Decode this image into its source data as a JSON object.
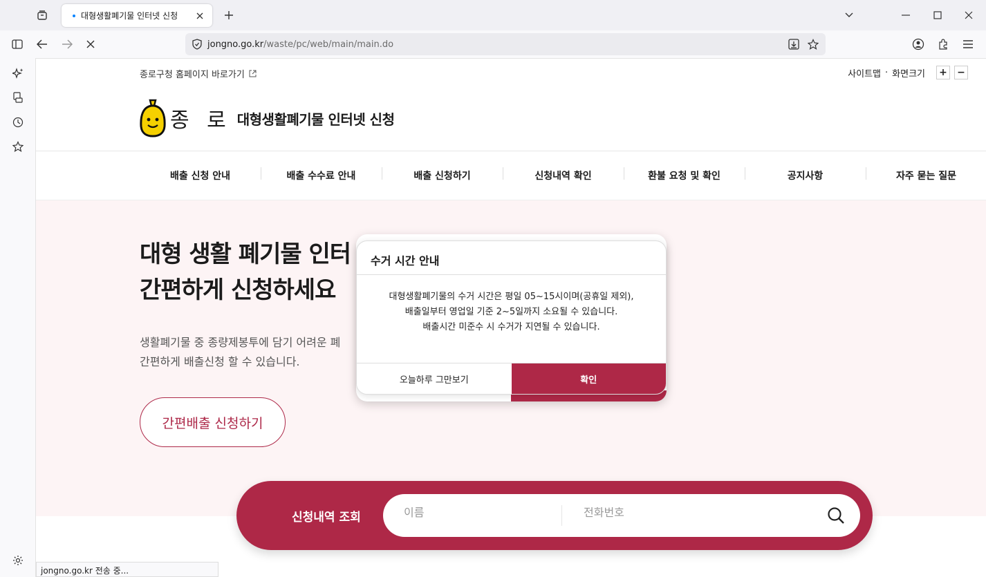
{
  "browser": {
    "tab_title": "대형생활폐기물 인터넷 신청",
    "url_domain": "jongno.go.kr",
    "url_path": "/waste/pc/web/main/main.do",
    "status_text": "jongno.go.kr 전송 중..."
  },
  "header": {
    "homepage_link": "종로구청 홈페이지 바로가기",
    "sitemap": "사이트맵",
    "dot": "·",
    "zoom_label": "화면크기",
    "zoom_in": "+",
    "zoom_out": "−",
    "logo_text": "종 로",
    "site_title": "대형생활폐기물 인터넷 신청"
  },
  "nav": {
    "items": [
      "배출 신청 안내",
      "배출 수수료 안내",
      "배출 신청하기",
      "신청내역 확인",
      "환불 요청 및 확인",
      "공지사항",
      "자주 묻는 질문"
    ]
  },
  "hero": {
    "title": "대형 생활 폐기물 인터\n간편하게 신청하세요",
    "desc": "생활폐기물 중 종량제봉투에 담기 어려운 폐\n간편하게 배출신청 할 수 있습니다.",
    "button": "간편배출 신청하기"
  },
  "search": {
    "label": "신청내역 조회",
    "name_placeholder": "이름",
    "phone_placeholder": "전화번호"
  },
  "modal": {
    "title": "수거 시간 안내",
    "line1": "대형생활폐기물의 수거 시간은 평일 05~15시이며(공휴일 제외),",
    "line2": "배출일부터 영업일 기준 2~5일까지 소요될 수 있습니다.",
    "line3": "배출시간 미준수 시 수거가 지연될 수 있습니다.",
    "hide_today": "오늘하루 그만보기",
    "confirm": "확인"
  },
  "colors": {
    "brand": "#ae2847",
    "hero_bg": "#fdf4f5",
    "logo_yellow": "#f5d000"
  }
}
